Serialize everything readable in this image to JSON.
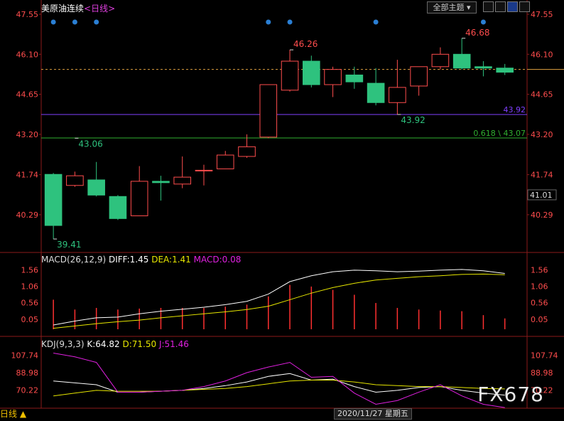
{
  "header": {
    "instrument": "美原油连续",
    "period": "<日线>",
    "theme_button": "全部主题",
    "icons": [
      "grid-icon",
      "window-icon",
      "chart-type-icon",
      "expand-icon"
    ]
  },
  "colors": {
    "up": "#ff4d4d",
    "down": "#2ec27e",
    "price_axis": "#ff4d4d",
    "macd_diff": "#ffffff",
    "macd_dea": "#e6e600",
    "macd_bar": "#ff3030",
    "kdj_k": "#ffffff",
    "kdj_d": "#e6e600",
    "kdj_j": "#e020e0"
  },
  "chart_data": [
    {
      "type": "candlestick",
      "y_ticks": [
        "47.55",
        "46.10",
        "44.65",
        "43.20",
        "41.74",
        "40.29"
      ],
      "ylim": [
        39.0,
        47.55
      ],
      "current_price_label": "41.01",
      "candles": [
        {
          "o": 41.75,
          "h": 41.8,
          "c": 39.9,
          "l": 39.41
        },
        {
          "o": 41.35,
          "h": 41.85,
          "c": 41.7,
          "l": 41.3
        },
        {
          "o": 41.55,
          "h": 42.2,
          "c": 41.0,
          "l": 40.95
        },
        {
          "o": 40.95,
          "h": 41.0,
          "c": 40.15,
          "l": 40.1
        },
        {
          "o": 40.25,
          "h": 42.05,
          "c": 41.5,
          "l": 40.25
        },
        {
          "o": 41.5,
          "h": 41.7,
          "c": 41.45,
          "l": 40.8
        },
        {
          "o": 41.4,
          "h": 42.4,
          "c": 41.65,
          "l": 41.25
        },
        {
          "o": 41.9,
          "h": 42.1,
          "c": 41.9,
          "l": 41.35
        },
        {
          "o": 41.95,
          "h": 42.6,
          "c": 42.45,
          "l": 41.95
        },
        {
          "o": 42.4,
          "h": 43.2,
          "c": 42.75,
          "l": 42.35
        },
        {
          "o": 43.1,
          "h": 45.0,
          "c": 45.0,
          "l": 43.06
        },
        {
          "o": 44.8,
          "h": 46.26,
          "c": 45.85,
          "l": 44.75
        },
        {
          "o": 45.85,
          "h": 46.05,
          "c": 45.0,
          "l": 44.9
        },
        {
          "o": 45.0,
          "h": 45.65,
          "c": 45.55,
          "l": 44.55
        },
        {
          "o": 45.35,
          "h": 45.65,
          "c": 45.1,
          "l": 44.85
        },
        {
          "o": 45.05,
          "h": 45.6,
          "c": 44.35,
          "l": 44.25
        },
        {
          "o": 44.35,
          "h": 45.9,
          "c": 44.9,
          "l": 43.92
        },
        {
          "o": 44.95,
          "h": 45.65,
          "c": 45.65,
          "l": 44.6
        },
        {
          "o": 45.65,
          "h": 46.35,
          "c": 46.1,
          "l": 45.55
        },
        {
          "o": 46.1,
          "h": 46.68,
          "c": 45.6,
          "l": 45.55
        },
        {
          "o": 45.65,
          "h": 45.85,
          "c": 45.6,
          "l": 45.3
        },
        {
          "o": 45.6,
          "h": 45.75,
          "c": 45.45,
          "l": 45.35
        }
      ],
      "annotations": [
        {
          "text": "46.26",
          "candle": 11,
          "price": 46.26
        },
        {
          "text": "46.68",
          "candle": 19,
          "price": 46.68
        },
        {
          "text": "43.06",
          "candle": 1,
          "price": 43.06
        },
        {
          "text": "39.41",
          "candle": 0,
          "price": 39.41
        },
        {
          "text": "43.92",
          "candle": 16,
          "price": 43.92
        }
      ],
      "reference_lines": [
        {
          "price": 45.55,
          "style": "dashed",
          "color": "#e0a040",
          "label": ""
        },
        {
          "price": 43.92,
          "style": "solid",
          "color": "#8040ff",
          "label": "43.92"
        },
        {
          "price": 43.07,
          "style": "solid",
          "color": "#30b030",
          "label": "0.618 \\ 43.07"
        }
      ],
      "event_dots": [
        0,
        1,
        2,
        10,
        11,
        15,
        20
      ]
    },
    {
      "type": "line",
      "title": "MACD(26,12,9)",
      "readouts": [
        {
          "label": "DIFF:1.45",
          "color": "#ffffff"
        },
        {
          "label": "DEA:1.41",
          "color": "#e6e600"
        },
        {
          "label": "MACD:0.08",
          "color": "#e020e0"
        }
      ],
      "y_ticks": [
        "1.56",
        "1.06",
        "0.56",
        "0.05"
      ],
      "ylim": [
        -0.25,
        1.72
      ],
      "series": [
        {
          "values": [
            -0.12,
            0.0,
            0.1,
            0.12,
            0.22,
            0.3,
            0.36,
            0.42,
            0.5,
            0.6,
            0.82,
            1.2,
            1.38,
            1.5,
            1.55,
            1.53,
            1.5,
            1.52,
            1.55,
            1.57,
            1.53,
            1.45
          ]
        },
        {
          "values": [
            -0.22,
            -0.15,
            -0.08,
            -0.02,
            0.03,
            0.1,
            0.16,
            0.22,
            0.28,
            0.35,
            0.45,
            0.65,
            0.85,
            1.02,
            1.15,
            1.25,
            1.3,
            1.35,
            1.38,
            1.42,
            1.43,
            1.41
          ]
        }
      ],
      "bars": [
        0.65,
        0.35,
        0.4,
        0.35,
        0.38,
        0.4,
        0.4,
        0.4,
        0.44,
        0.5,
        0.75,
        1.1,
        1.05,
        0.95,
        0.8,
        0.55,
        0.4,
        0.35,
        0.32,
        0.3,
        0.18,
        0.08
      ]
    },
    {
      "type": "line",
      "title": "KDJ(9,3,3)",
      "readouts": [
        {
          "label": "K:64.82",
          "color": "#ffffff"
        },
        {
          "label": "D:71.50",
          "color": "#e6e600"
        },
        {
          "label": "J:51.46",
          "color": "#e020e0"
        }
      ],
      "y_ticks": [
        "107.74",
        "88.98",
        "70.22"
      ],
      "ylim": [
        50,
        115
      ],
      "series": [
        {
          "values": [
            80,
            78,
            76,
            68,
            68,
            69,
            70,
            72,
            75,
            79,
            85,
            88,
            81,
            82,
            74,
            68,
            70,
            73,
            74,
            70,
            67,
            64.82
          ]
        },
        {
          "values": [
            64,
            67,
            70,
            69,
            69,
            69,
            70,
            71,
            72,
            74,
            77,
            80,
            81,
            81,
            79,
            76,
            75,
            74,
            74,
            73,
            72,
            71.5
          ]
        },
        {
          "values": [
            110,
            106,
            100,
            68,
            68,
            69,
            70,
            74,
            80,
            89,
            95,
            100,
            84,
            85,
            67,
            55,
            59,
            68,
            76,
            64,
            55,
            51.46
          ]
        }
      ]
    }
  ],
  "footer": {
    "period_button": "日线 ▲",
    "cursor_date": "2020/11/27 星期五",
    "watermark": "FX678"
  }
}
